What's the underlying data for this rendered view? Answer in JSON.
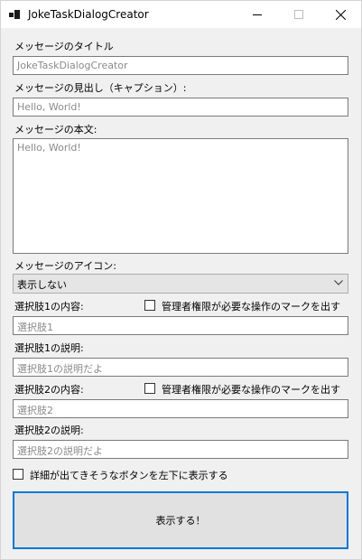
{
  "window": {
    "title": "JokeTaskDialogCreator"
  },
  "fields": {
    "title_label": "メッセージのタイトル",
    "title_placeholder": "JokeTaskDialogCreator",
    "caption_label": "メッセージの見出し（キャプション）:",
    "caption_placeholder": "Hello, World!",
    "body_label": "メッセージの本文:",
    "body_placeholder": "Hello, World!",
    "icon_label": "メッセージのアイコン:",
    "icon_selected": "表示しない"
  },
  "choice1": {
    "content_label": "選択肢1の内容:",
    "admin_check_label": "管理者権限が必要な操作のマークを出す",
    "admin_checked": false,
    "content_placeholder": "選択肢1",
    "desc_label": "選択肢1の説明:",
    "desc_placeholder": "選択肢1の説明だよ"
  },
  "choice2": {
    "content_label": "選択肢2の内容:",
    "admin_check_label": "管理者権限が必要な操作のマークを出す",
    "admin_checked": false,
    "content_placeholder": "選択肢2",
    "desc_label": "選択肢2の説明:",
    "desc_placeholder": "選択肢2の説明だよ"
  },
  "details_check": {
    "label": "詳細が出てきそうなボタンを左下に表示する",
    "checked": false
  },
  "show_button": {
    "label": "表示する！"
  },
  "colors": {
    "accent": "#0078d7",
    "placeholder_text": "#8a8a8a",
    "window_bg": "#f0f0f0"
  }
}
